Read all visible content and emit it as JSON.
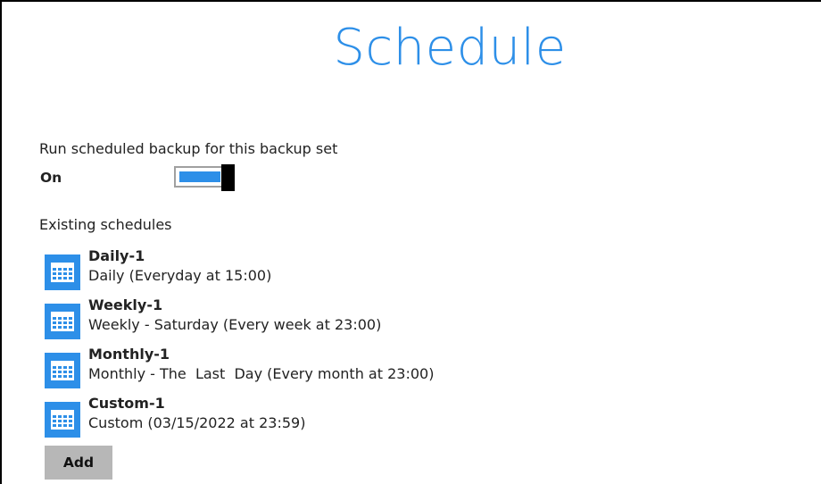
{
  "page": {
    "title": "Schedule"
  },
  "run_schedule": {
    "label": "Run scheduled backup for this backup set",
    "state_label": "On",
    "enabled": true
  },
  "existing": {
    "label": "Existing schedules",
    "icon": "calendar-icon",
    "items": [
      {
        "name": "Daily-1",
        "description": "Daily (Everyday at 15:00)"
      },
      {
        "name": "Weekly-1",
        "description": "Weekly - Saturday (Every week at 23:00)"
      },
      {
        "name": "Monthly-1",
        "description": "Monthly - The  Last  Day (Every month at 23:00)"
      },
      {
        "name": "Custom-1",
        "description": "Custom (03/15/2022 at 23:59)"
      }
    ]
  },
  "actions": {
    "add_label": "Add"
  },
  "colors": {
    "title": "#2d8fe8",
    "accent": "#2d8fe8",
    "toggle_thumb": "#000000",
    "button_bg": "#b7b7b7"
  }
}
